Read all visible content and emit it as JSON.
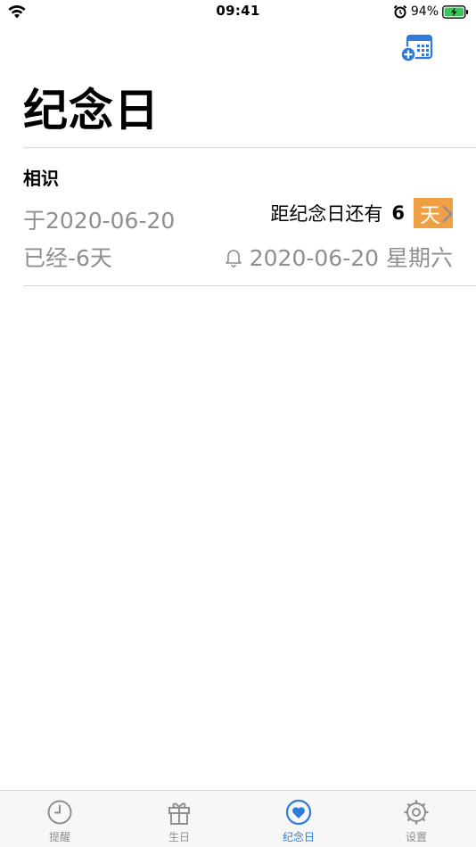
{
  "status_bar": {
    "time": "09:41",
    "battery_percent": "94%"
  },
  "header": {
    "title": "纪念日",
    "add_button_icon": "calendar-add-icon"
  },
  "anniversaries": [
    {
      "name": "相识",
      "date_text": "于2020-06-20",
      "elapsed_text": "已经-6天",
      "until_label": "距纪念日还有",
      "until_days": "6",
      "until_unit": "天",
      "reminder_text": "2020-06-20 星期六"
    }
  ],
  "tab_bar": {
    "tabs": [
      {
        "label": "提醒",
        "icon": "clock-icon",
        "active": false
      },
      {
        "label": "生日",
        "icon": "gift-icon",
        "active": false
      },
      {
        "label": "纪念日",
        "icon": "heart-icon",
        "active": true
      },
      {
        "label": "设置",
        "icon": "gear-icon",
        "active": false
      }
    ]
  },
  "colors": {
    "accent": "#2f7bd9",
    "badge": "#f0a044",
    "secondary_text": "#8e8e93"
  }
}
